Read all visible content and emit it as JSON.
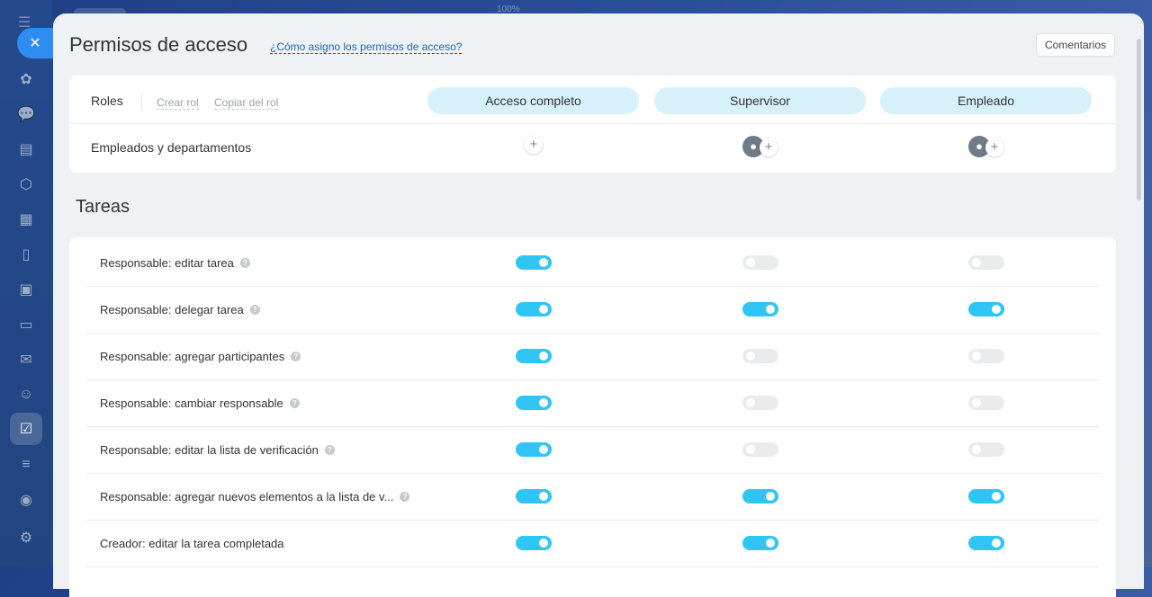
{
  "window": {
    "zoom_label": "100%"
  },
  "panel": {
    "title": "Permisos de acceso",
    "help_link": "¿Cómo asigno los permisos de acceso?",
    "comments_button": "Comentarios"
  },
  "roles": {
    "label": "Roles",
    "create_link": "Crear rol",
    "copy_link": "Copiar del rol",
    "items": [
      "Acceso completo",
      "Supervisor",
      "Empleado"
    ],
    "employees_label": "Empleados y departamentos",
    "plus_symbol": "+"
  },
  "section": {
    "title": "Tareas"
  },
  "permissions": [
    {
      "label": "Responsable: editar tarea",
      "help": true,
      "values": [
        true,
        false,
        false
      ]
    },
    {
      "label": "Responsable: delegar tarea",
      "help": true,
      "values": [
        true,
        true,
        true
      ]
    },
    {
      "label": "Responsable: agregar participantes",
      "help": true,
      "values": [
        true,
        false,
        false
      ]
    },
    {
      "label": "Responsable: cambiar responsable",
      "help": true,
      "values": [
        true,
        false,
        false
      ]
    },
    {
      "label": "Responsable: editar la lista de verificación",
      "help": true,
      "values": [
        true,
        false,
        false
      ]
    },
    {
      "label": "Responsable: agregar nuevos elementos a la lista de v...",
      "help": true,
      "values": [
        true,
        true,
        true
      ]
    },
    {
      "label": "Creador: editar la tarea completada",
      "help": false,
      "values": [
        true,
        true,
        true
      ]
    }
  ],
  "colors": {
    "toggle_on": "#2fc6f6",
    "toggle_off": "#e9ebed",
    "role_pill": "#d6f1fb",
    "link": "#2067b0"
  }
}
